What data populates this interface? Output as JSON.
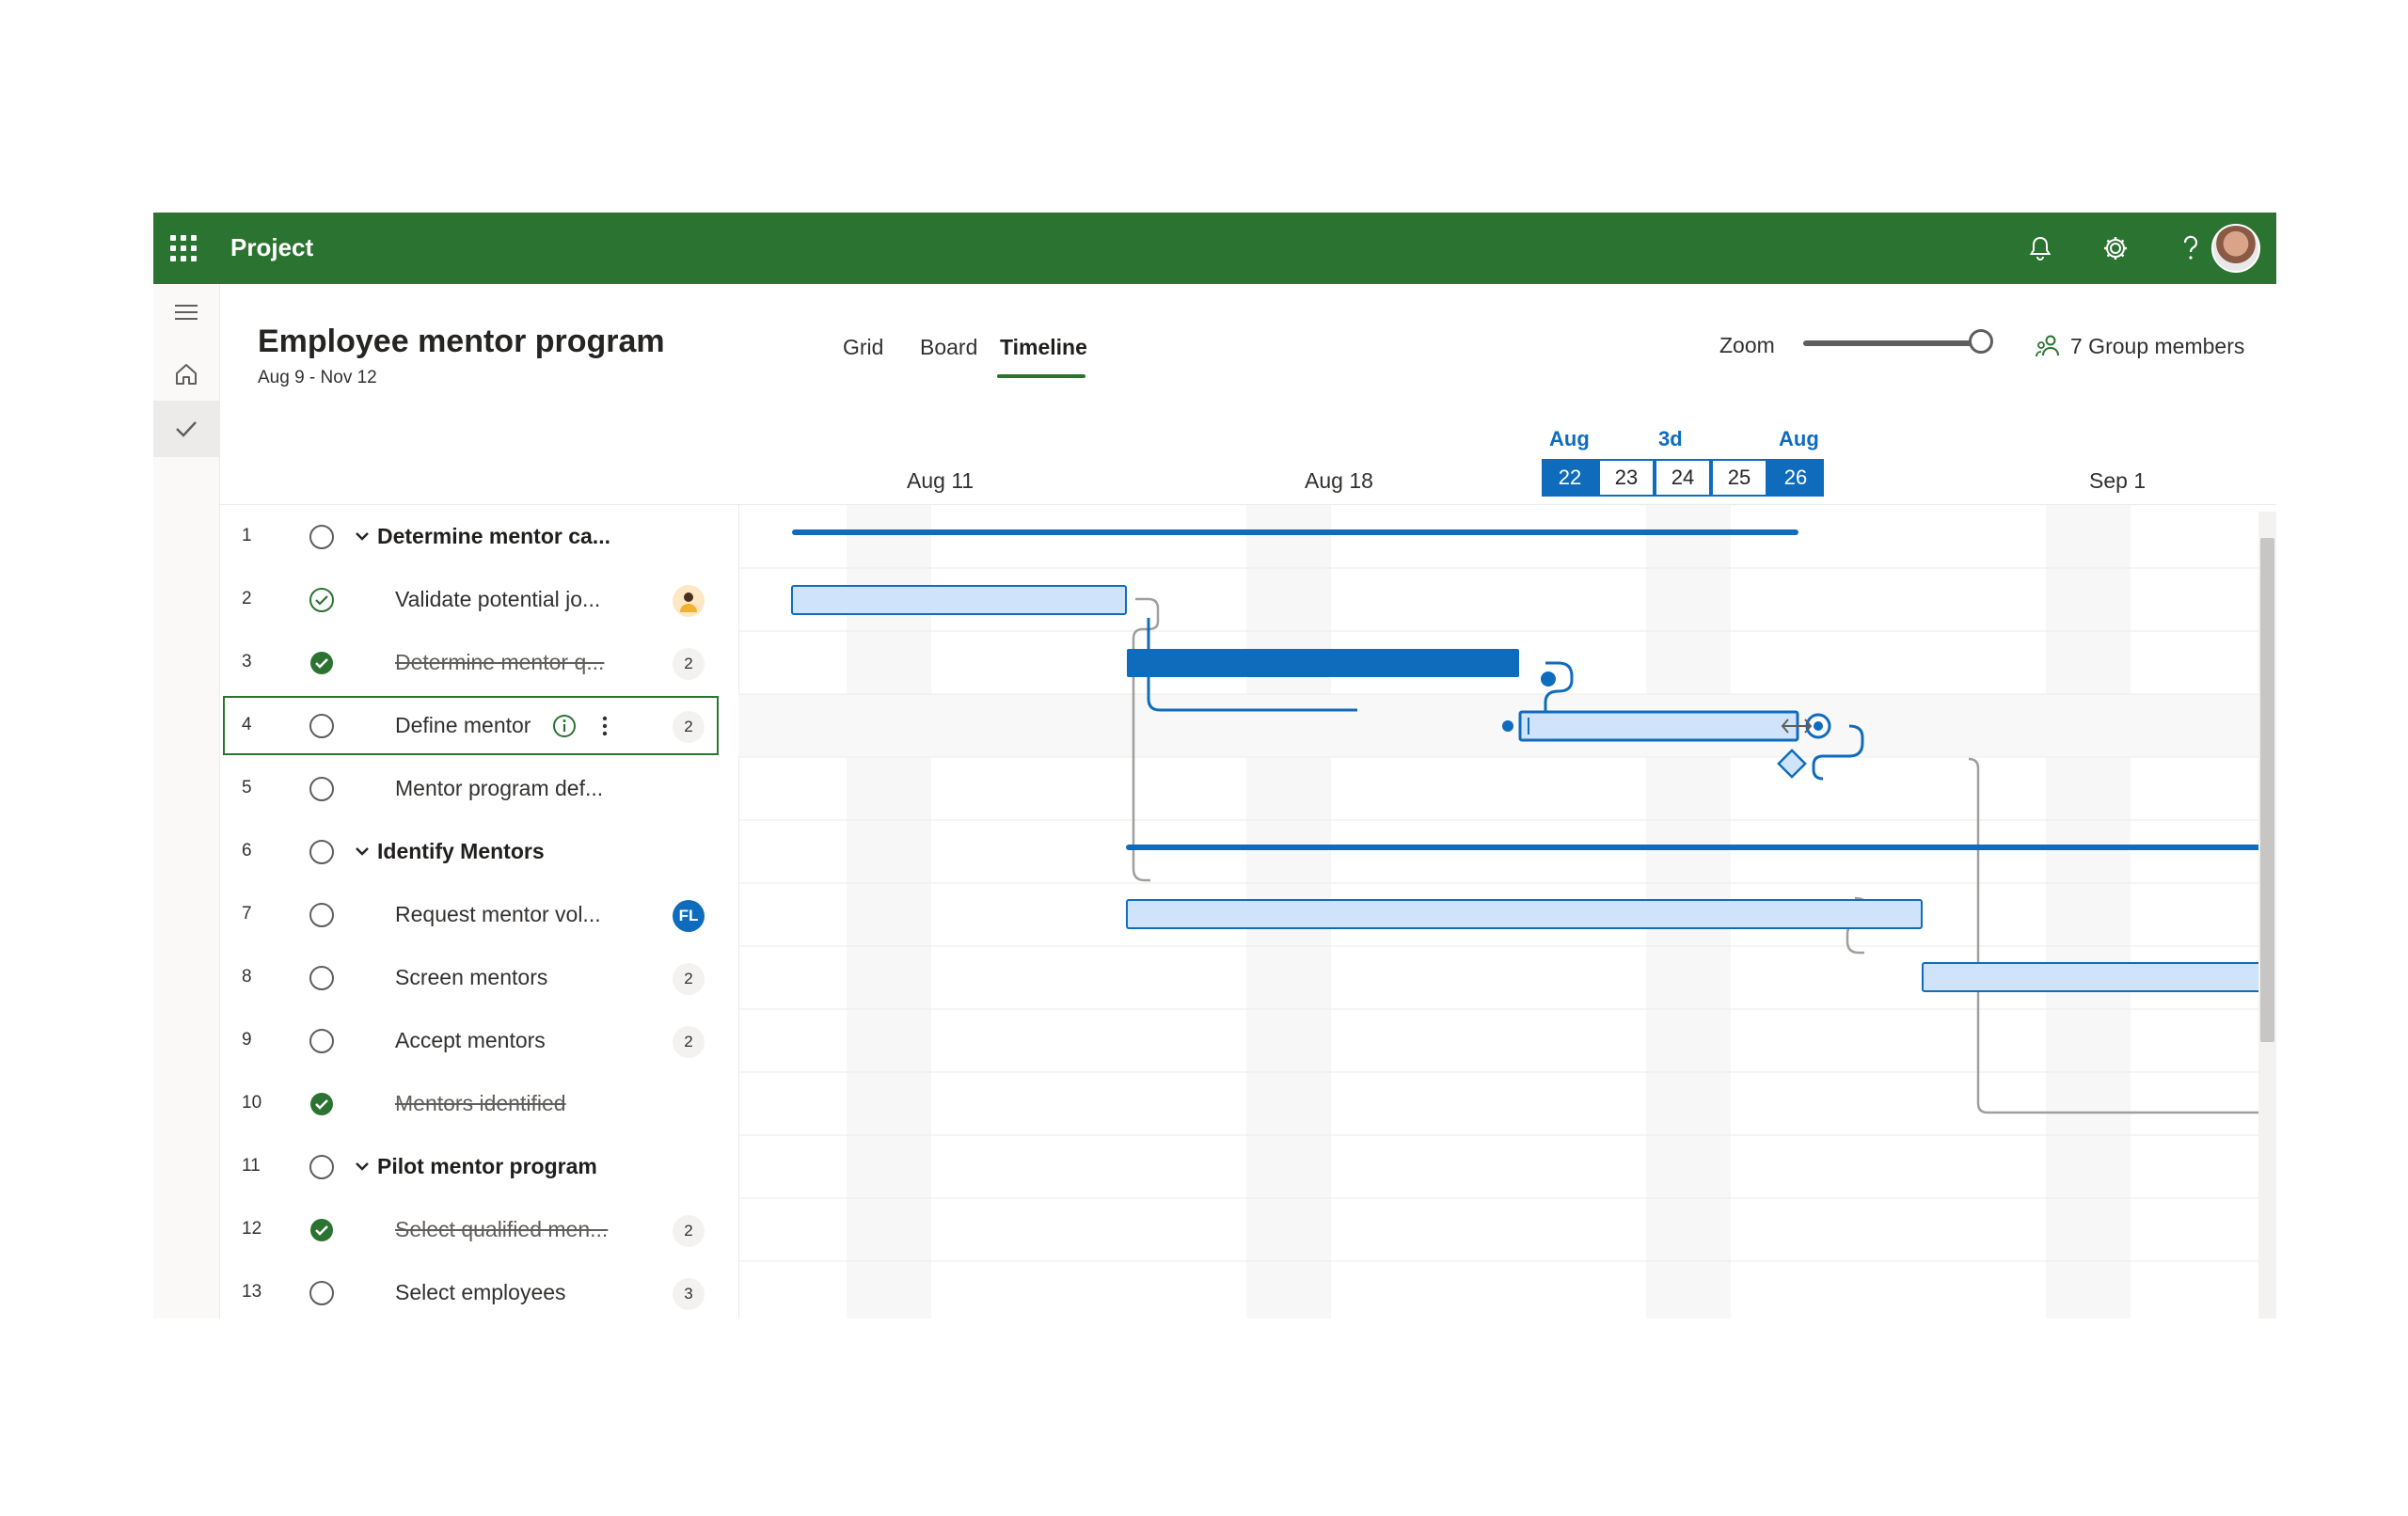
{
  "header": {
    "app_name": "Project"
  },
  "project": {
    "title": "Employee mentor program",
    "dates": "Aug 9 - Nov 12"
  },
  "tabs": [
    {
      "label": "Grid"
    },
    {
      "label": "Board"
    },
    {
      "label": "Timeline"
    }
  ],
  "active_tab": "Timeline",
  "zoom": {
    "label": "Zoom",
    "level": 1.0
  },
  "members": {
    "label": "7 Group members"
  },
  "timescale": {
    "weeks": [
      "Aug 11",
      "Aug 18",
      "Sep 1"
    ],
    "selection_top": [
      "Aug",
      "3d",
      "Aug"
    ],
    "days": [
      "22",
      "23",
      "24",
      "25",
      "26"
    ]
  },
  "tasks": [
    {
      "num": "1",
      "name": "Determine mentor ca...",
      "summary": true,
      "status": "open"
    },
    {
      "num": "2",
      "name": "Validate potential jo...",
      "status": "in-progress",
      "assignee": "person"
    },
    {
      "num": "3",
      "name": "Determine mentor q...",
      "status": "done",
      "badge": "2"
    },
    {
      "num": "4",
      "name": "Define mentor",
      "status": "open",
      "badge": "2",
      "selected": true
    },
    {
      "num": "5",
      "name": "Mentor program def...",
      "status": "open"
    },
    {
      "num": "6",
      "name": "Identify Mentors",
      "summary": true,
      "status": "open"
    },
    {
      "num": "7",
      "name": "Request mentor vol...",
      "status": "open",
      "badge": "FL"
    },
    {
      "num": "8",
      "name": "Screen mentors",
      "status": "open",
      "badge": "2"
    },
    {
      "num": "9",
      "name": "Accept mentors",
      "status": "open",
      "badge": "2"
    },
    {
      "num": "10",
      "name": "Mentors identified",
      "status": "done"
    },
    {
      "num": "11",
      "name": "Pilot mentor program",
      "summary": true,
      "status": "open"
    },
    {
      "num": "12",
      "name": "Select qualified men...",
      "status": "done",
      "badge": "2"
    },
    {
      "num": "13",
      "name": "Select employees",
      "status": "open",
      "badge": "3"
    }
  ],
  "colors": {
    "brand": "#2b7330",
    "accent": "#0f6cbd",
    "bar_fill": "#cfe4fa"
  }
}
